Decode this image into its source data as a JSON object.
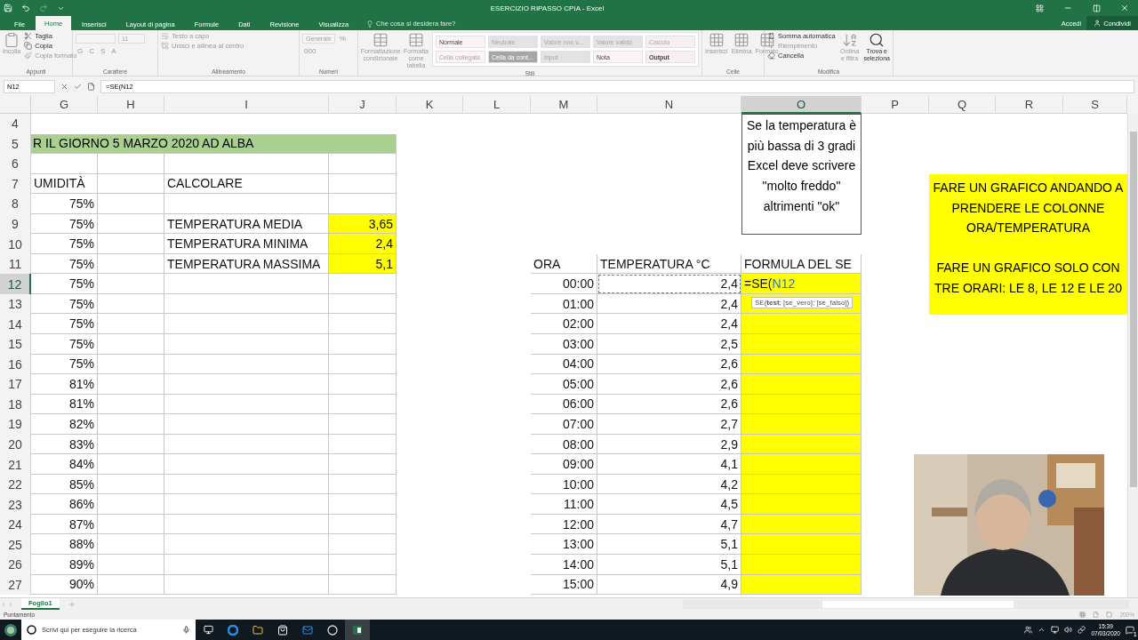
{
  "window": {
    "title": "ESERCIZIO RIPASSO CPIA - Excel",
    "sign_in": "Accedi",
    "share": "Condividi"
  },
  "tabs": [
    {
      "label": "File",
      "selected": false
    },
    {
      "label": "Home",
      "selected": true
    },
    {
      "label": "Inserisci",
      "selected": false
    },
    {
      "label": "Layout di pagina",
      "selected": false
    },
    {
      "label": "Formule",
      "selected": false
    },
    {
      "label": "Dati",
      "selected": false
    },
    {
      "label": "Revisione",
      "selected": false
    },
    {
      "label": "Visualizza",
      "selected": false
    }
  ],
  "tell_me": {
    "placeholder": "Che cosa si desidera fare?"
  },
  "ribbon": [
    {
      "label": "Appunti",
      "items": [
        {
          "kind": "large",
          "label": "Incolla",
          "disabled": true
        },
        {
          "kind": "small",
          "label": "Taglia",
          "disabled": false
        },
        {
          "kind": "small",
          "label": "Copia",
          "disabled": false
        },
        {
          "kind": "small",
          "label": "Copia formato",
          "disabled": true
        }
      ]
    },
    {
      "label": "Carattere",
      "items": [
        {
          "kind": "field",
          "disabled": true
        },
        {
          "kind": "field",
          "label": "11",
          "disabled": true
        },
        {
          "kind": "glyph",
          "label": "G",
          "disabled": true
        },
        {
          "kind": "glyph",
          "label": "C",
          "disabled": true
        },
        {
          "kind": "glyph",
          "label": "S",
          "disabled": true
        },
        {
          "kind": "glyph",
          "label": "A",
          "disabled": true
        }
      ]
    },
    {
      "label": "Allineamento",
      "items": [
        {
          "kind": "small",
          "label": "Testo a capo",
          "disabled": true
        },
        {
          "kind": "small",
          "label": "Unisci e allinea al centro",
          "disabled": true
        }
      ]
    },
    {
      "label": "Numeri",
      "items": [
        {
          "kind": "field",
          "label": "Generale",
          "disabled": true
        },
        {
          "kind": "glyph",
          "label": "%",
          "disabled": true
        },
        {
          "kind": "glyph",
          "label": "000",
          "disabled": true
        }
      ]
    },
    {
      "label": "Stili",
      "items": [
        {
          "kind": "large",
          "label": "Formattazione condizionale",
          "disabled": true
        },
        {
          "kind": "large",
          "label": "Formatta come tabella",
          "disabled": true
        },
        {
          "kind": "style",
          "label": "Normale",
          "disabled": false,
          "color": "#fbf3f5"
        },
        {
          "kind": "style",
          "label": "Neutrale",
          "disabled": true,
          "color": "#e4e2e4"
        },
        {
          "kind": "style",
          "label": "Valore non v...",
          "disabled": true,
          "color": "#e4e2e4"
        },
        {
          "kind": "style",
          "label": "Valore valido",
          "disabled": true,
          "color": "#e4e2e4"
        },
        {
          "kind": "style",
          "label": "Calcolo",
          "disabled": true,
          "color": "#f7eef0"
        },
        {
          "kind": "style",
          "label": "Cella collegata",
          "disabled": true,
          "color": "#fbf3f5"
        },
        {
          "kind": "style",
          "label": "Cella da cont...",
          "disabled": true,
          "color": "#a6a6a6"
        },
        {
          "kind": "style",
          "label": "Input",
          "disabled": true,
          "color": "#e4e2e4"
        },
        {
          "kind": "style",
          "label": "Nota",
          "disabled": false,
          "color": "#fbf3f5"
        },
        {
          "kind": "style",
          "label": "Output",
          "disabled": false,
          "color": "#f7eef0"
        }
      ]
    },
    {
      "label": "Celle",
      "items": [
        {
          "kind": "large",
          "label": "Inserisci",
          "disabled": true
        },
        {
          "kind": "large",
          "label": "Elimina",
          "disabled": true
        },
        {
          "kind": "large",
          "label": "Formato",
          "disabled": true
        }
      ]
    },
    {
      "label": "Modifica",
      "items": [
        {
          "kind": "small",
          "label": "Somma automatica",
          "disabled": false
        },
        {
          "kind": "small",
          "label": "Riempimento",
          "disabled": true
        },
        {
          "kind": "small",
          "label": "Cancella",
          "disabled": false
        },
        {
          "kind": "large",
          "label": "Ordina e filtra",
          "disabled": true
        },
        {
          "kind": "large",
          "label": "Trova e seleziona",
          "disabled": false
        }
      ]
    }
  ],
  "formula_bar": {
    "name_box": "N12",
    "formula": "=SE(N12"
  },
  "columns": [
    {
      "label": "G",
      "selected": false
    },
    {
      "label": "H",
      "selected": false
    },
    {
      "label": "I",
      "selected": false
    },
    {
      "label": "J",
      "selected": false
    },
    {
      "label": "K",
      "selected": false
    },
    {
      "label": "L",
      "selected": false
    },
    {
      "label": "M",
      "selected": false
    },
    {
      "label": "N",
      "selected": false
    },
    {
      "label": "O",
      "selected": true
    },
    {
      "label": "P",
      "selected": false
    },
    {
      "label": "Q",
      "selected": false
    },
    {
      "label": "R",
      "selected": false
    },
    {
      "label": "S",
      "selected": false
    }
  ],
  "rows": [
    {
      "num": "4",
      "selected": false,
      "cells": []
    },
    {
      "num": "5",
      "selected": false,
      "banner": "R IL GIORNO 5 MARZO 2020 AD ALBA",
      "cells": []
    },
    {
      "num": "6",
      "selected": false,
      "cells": []
    },
    {
      "num": "7",
      "selected": false,
      "cells": [
        {
          "text": "UMIDITÀ",
          "kind": "header"
        },
        null,
        "CALCOLARE"
      ]
    },
    {
      "num": "8",
      "selected": false,
      "cells": [
        "75%"
      ]
    },
    {
      "num": "9",
      "selected": false,
      "cells": [
        "75%",
        null,
        "TEMPERATURA MEDIA",
        {
          "text": "3,65",
          "highlighted": true
        }
      ]
    },
    {
      "num": "10",
      "selected": false,
      "cells": [
        "75%",
        null,
        "TEMPERATURA MINIMA",
        {
          "text": "2,4",
          "highlighted": true
        }
      ]
    },
    {
      "num": "11",
      "selected": false,
      "cells": [
        "75%",
        null,
        "TEMPERATURA MASSIMA",
        {
          "text": "5,1",
          "highlighted": true
        },
        null,
        null,
        {
          "text": "ORA",
          "kind": "header"
        },
        {
          "text": "TEMPERATURA °C",
          "kind": "header"
        },
        "FORMULA DEL SE"
      ]
    },
    {
      "num": "12",
      "selected": true,
      "cells": [
        "75%",
        null,
        null,
        null,
        null,
        null,
        "00:00",
        {
          "text": "2,4",
          "referenced": true
        },
        {
          "kind": "editing",
          "text": "=SE(",
          "ref": "N12",
          "highlighted": true
        }
      ]
    },
    {
      "num": "13",
      "selected": false,
      "cells": [
        "75%",
        null,
        null,
        null,
        null,
        null,
        "01:00",
        "2,4",
        {
          "highlighted": true
        }
      ]
    },
    {
      "num": "14",
      "selected": false,
      "cells": [
        "75%",
        null,
        null,
        null,
        null,
        null,
        "02:00",
        "2,4",
        {
          "highlighted": true
        }
      ]
    },
    {
      "num": "15",
      "selected": false,
      "cells": [
        "75%",
        null,
        null,
        null,
        null,
        null,
        "03:00",
        "2,5",
        {
          "highlighted": true
        }
      ]
    },
    {
      "num": "16",
      "selected": false,
      "cells": [
        "75%",
        null,
        null,
        null,
        null,
        null,
        "04:00",
        "2,6",
        {
          "highlighted": true
        }
      ]
    },
    {
      "num": "17",
      "selected": false,
      "cells": [
        "81%",
        null,
        null,
        null,
        null,
        null,
        "05:00",
        "2,6",
        {
          "highlighted": true
        }
      ]
    },
    {
      "num": "18",
      "selected": false,
      "cells": [
        "81%",
        null,
        null,
        null,
        null,
        null,
        "06:00",
        "2,6",
        {
          "highlighted": true
        }
      ]
    },
    {
      "num": "19",
      "selected": false,
      "cells": [
        "82%",
        null,
        null,
        null,
        null,
        null,
        "07:00",
        "2,7",
        {
          "highlighted": true
        }
      ]
    },
    {
      "num": "20",
      "selected": false,
      "cells": [
        "83%",
        null,
        null,
        null,
        null,
        null,
        "08:00",
        "2,9",
        {
          "highlighted": true
        }
      ]
    },
    {
      "num": "21",
      "selected": false,
      "cells": [
        "84%",
        null,
        null,
        null,
        null,
        null,
        "09:00",
        "4,1",
        {
          "highlighted": true
        }
      ]
    },
    {
      "num": "22",
      "selected": false,
      "cells": [
        "85%",
        null,
        null,
        null,
        null,
        null,
        "10:00",
        "4,2",
        {
          "highlighted": true
        }
      ]
    },
    {
      "num": "23",
      "selected": false,
      "cells": [
        "86%",
        null,
        null,
        null,
        null,
        null,
        "11:00",
        "4,5",
        {
          "highlighted": true
        }
      ]
    },
    {
      "num": "24",
      "selected": false,
      "cells": [
        "87%",
        null,
        null,
        null,
        null,
        null,
        "12:00",
        "4,7",
        {
          "highlighted": true
        }
      ]
    },
    {
      "num": "25",
      "selected": false,
      "cells": [
        "88%",
        null,
        null,
        null,
        null,
        null,
        "13:00",
        "5,1",
        {
          "highlighted": true
        }
      ]
    },
    {
      "num": "26",
      "selected": false,
      "cells": [
        "89%",
        null,
        null,
        null,
        null,
        null,
        "14:00",
        "5,1",
        {
          "highlighted": true
        }
      ]
    },
    {
      "num": "27",
      "selected": false,
      "cells": [
        "90%",
        null,
        null,
        null,
        null,
        null,
        "15:00",
        "4,9",
        {
          "highlighted": true
        }
      ]
    }
  ],
  "function_tooltip": "SE(**test**; [se_vero]; [se_falso])",
  "text_box": "Se la temperatura è più bassa di 3 gradi Excel deve scrivere \"molto freddo\" altrimenti \"ok\"",
  "note": [
    "FARE UN GRAFICO ANDANDO A PRENDERE LE COLONNE ORA/TEMPERATURA",
    "FARE UN GRAFICO SOLO CON TRE ORARI: LE 8, LE 12 E LE 20"
  ],
  "webcam": {
    "kind": "picture"
  },
  "sheet_tabs": [
    {
      "label": "Foglio1",
      "selected": true
    }
  ],
  "status_bar": {
    "mode": "Puntamento",
    "zoom": "200%"
  },
  "taskbar": {
    "search": {
      "placeholder": "Scrivi qui per eseguire la ricerca"
    },
    "time": "15:39",
    "date": "07/03/2020",
    "notifications": "1"
  }
}
